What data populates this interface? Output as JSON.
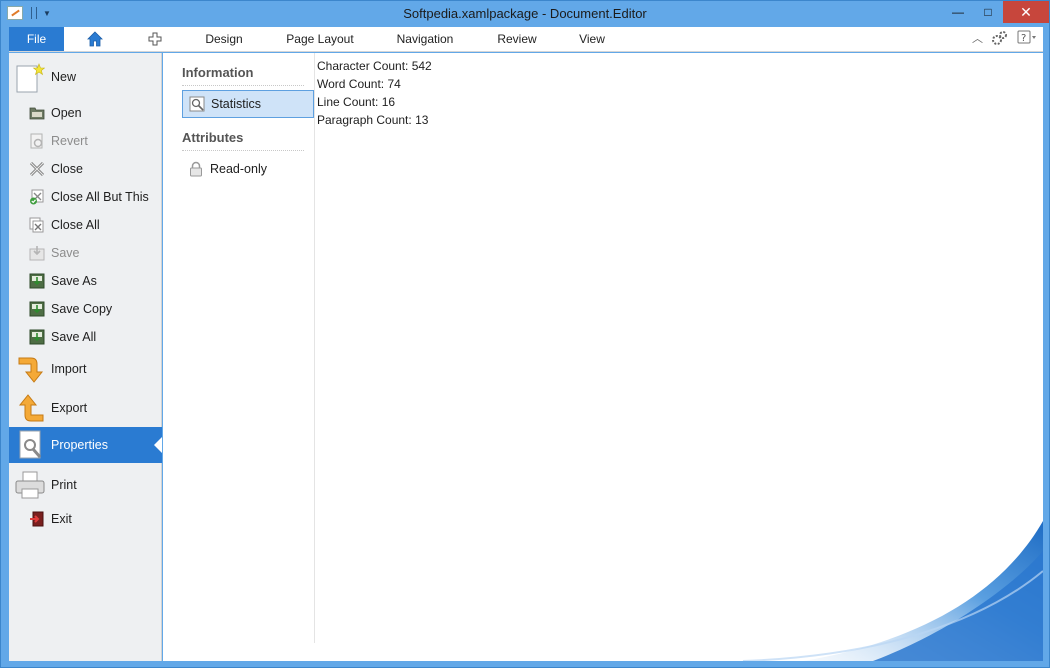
{
  "window": {
    "title": "Softpedia.xamlpackage - Document.Editor",
    "controls": {
      "minimize": "—",
      "maximize": "□",
      "close": "✕"
    }
  },
  "ribbon": {
    "tabs": [
      {
        "label": "File"
      },
      {
        "label": "Design"
      },
      {
        "label": "Page Layout"
      },
      {
        "label": "Navigation"
      },
      {
        "label": "Review"
      },
      {
        "label": "View"
      }
    ],
    "icons": [
      "home-icon",
      "plus-icon",
      "collapse-ribbon-icon",
      "settings-icon",
      "help-icon"
    ]
  },
  "backstage": {
    "items": [
      {
        "label": "New",
        "icon": "new-document-icon",
        "disabled": false
      },
      {
        "label": "Open",
        "icon": "open-folder-icon",
        "disabled": false
      },
      {
        "label": "Revert",
        "icon": "revert-icon",
        "disabled": true
      },
      {
        "label": "Close",
        "icon": "close-icon",
        "disabled": false
      },
      {
        "label": "Close All But This",
        "icon": "close-all-but-this-icon",
        "disabled": false
      },
      {
        "label": "Close All",
        "icon": "close-all-icon",
        "disabled": false
      },
      {
        "label": "Save",
        "icon": "save-icon",
        "disabled": true
      },
      {
        "label": "Save As",
        "icon": "save-as-icon",
        "disabled": false
      },
      {
        "label": "Save Copy",
        "icon": "save-copy-icon",
        "disabled": false
      },
      {
        "label": "Save All",
        "icon": "save-all-icon",
        "disabled": false
      },
      {
        "label": "Import",
        "icon": "import-icon",
        "disabled": false
      },
      {
        "label": "Export",
        "icon": "export-icon",
        "disabled": false
      },
      {
        "label": "Properties",
        "icon": "properties-icon",
        "disabled": false,
        "active": true
      },
      {
        "label": "Print",
        "icon": "printer-icon",
        "disabled": false
      },
      {
        "label": "Exit",
        "icon": "exit-icon",
        "disabled": false
      }
    ]
  },
  "properties": {
    "sections": [
      {
        "heading": "Information",
        "items": [
          {
            "label": "Statistics",
            "selected": true
          }
        ]
      },
      {
        "heading": "Attributes",
        "items": [
          {
            "label": "Read-only",
            "selected": false
          }
        ]
      }
    ],
    "statistics": [
      "Character Count: 542",
      "Word Count: 74",
      "Line Count: 16",
      "Paragraph Count: 13"
    ]
  },
  "colors": {
    "accent": "#2a7bd2",
    "titlebar": "#62a8e8",
    "close_button": "#c7463c",
    "backstage_bg": "#eef0f2",
    "selection_bg": "#cfe3f8"
  }
}
